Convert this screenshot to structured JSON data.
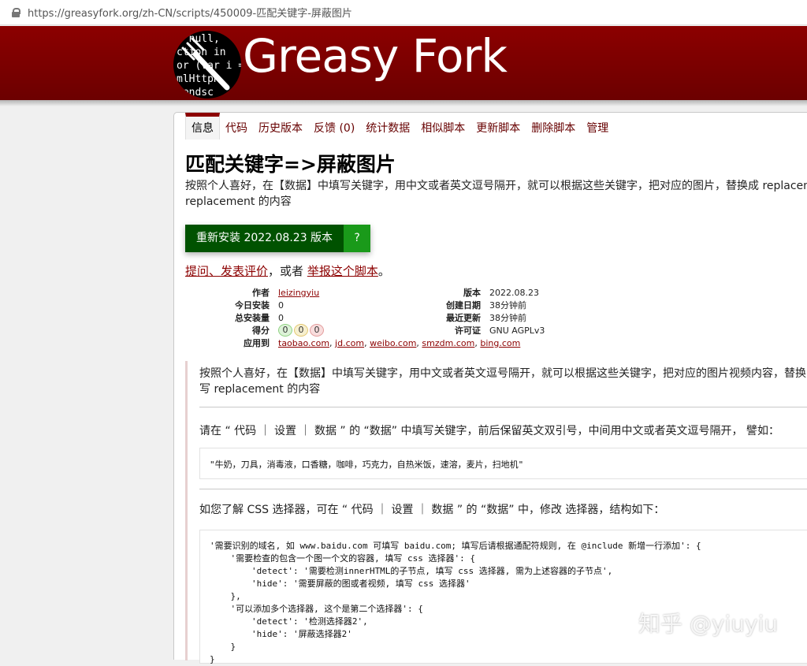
{
  "browser": {
    "url": "https://greasyfork.org/zh-CN/scripts/450009-匹配关键字-屏蔽图片"
  },
  "header": {
    "logo_code_lines": [
      "e null,",
      "ction in",
      "or (var i = 0",
      "mlHttpR",
      "sendsc"
    ],
    "brand": "Greasy Fork"
  },
  "tabs": [
    {
      "label": "信息",
      "active": true
    },
    {
      "label": "代码"
    },
    {
      "label": "历史版本"
    },
    {
      "label": "反馈 (0)"
    },
    {
      "label": "统计数据"
    },
    {
      "label": "相似脚本"
    },
    {
      "label": "更新脚本"
    },
    {
      "label": "删除脚本"
    },
    {
      "label": "管理"
    }
  ],
  "script": {
    "title": "匹配关键字=>屏蔽图片",
    "description_line1": "按照个人喜好，在【数据】中填写关键字，用中文或者英文逗号隔开，就可以根据这些关键字，把对应的图片，替换成 replacem",
    "description_line2": "replacement 的内容",
    "install_label": "重新安装 2022.08.23 版本",
    "install_help": "?",
    "feedback": {
      "link1": "提问、发表评价",
      "middle": "，或者",
      "link2": "举报这个脚本",
      "end": "。"
    }
  },
  "meta_left": [
    {
      "key": "作者",
      "value": "leizingyiu",
      "link": true
    },
    {
      "key": "今日安装",
      "value": "0"
    },
    {
      "key": "总安装量",
      "value": "0"
    },
    {
      "key": "得分",
      "scores": [
        "0",
        "0",
        "0"
      ]
    },
    {
      "key": "应用到",
      "sites": [
        "taobao.com",
        "jd.com",
        "weibo.com",
        "smzdm.com",
        "bing.com"
      ]
    }
  ],
  "meta_right": [
    {
      "key": "版本",
      "value": "2022.08.23"
    },
    {
      "key": "创建日期",
      "value": "38分钟前"
    },
    {
      "key": "最近更新",
      "value": "38分钟前"
    },
    {
      "key": "许可证",
      "value": "GNU AGPLv3"
    }
  ],
  "additional": {
    "p1_line1": "按照个人喜好，在【数据】中填写关键字，用中文或者英文逗号隔开，就可以根据这些关键字，把对应的图片视频内容，替换",
    "p1_line2": "写 replacement 的内容",
    "p2": "请在 “ 代码 ｜ 设置 ｜ 数据 ” 的 “数据” 中填写关键字，前后保留英文双引号，中间用中文或者英文逗号隔开， 譬如：",
    "code1": "\"牛奶，刀具，消毒液，口香糖，咖啡，巧克力，自热米饭，速溶，麦片，扫地机\"",
    "p3": "如您了解 CSS 选择器，可在 “ 代码 ｜ 设置 ｜ 数据 ” 的 “数据” 中，修改 选择器，结构如下：",
    "code2": [
      "'需要识别的域名, 如 www.baidu.com 可填写 baidu.com; 填写后请根据通配符规则, 在 @include 新增一行添加': {",
      "    '需要检查的包含一个图一个文的容器, 填写 css 选择器': {",
      "        'detect': '需要检测innerHTML的子节点, 填写 css 选择器, 需为上述容器的子节点',",
      "        'hide': '需要屏蔽的图或者视频, 填写 css 选择器'",
      "    },",
      "    '可以添加多个选择器, 这个是第二个选择器': {",
      "        'detect': '检测选择器2',",
      "        'hide': '屏蔽选择器2'",
      "    }",
      "}"
    ]
  },
  "watermark": "知乎 @yiuyiu"
}
